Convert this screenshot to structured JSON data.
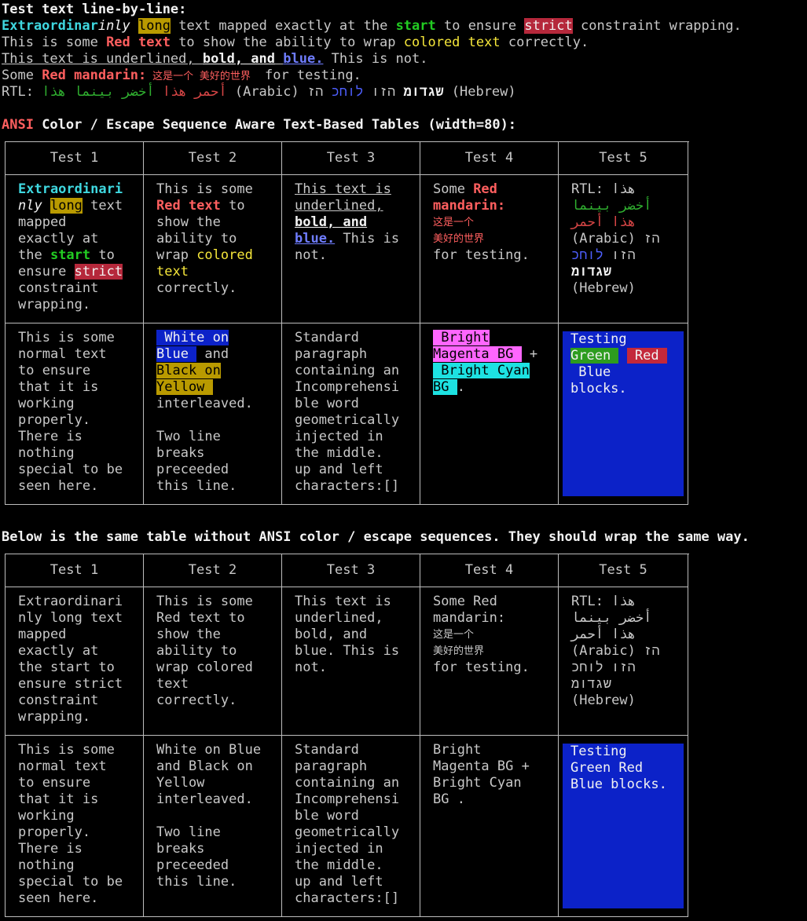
{
  "heading_line_by_line": "Test text line-by-line:",
  "line1": {
    "part_extra": "Extraordinar",
    "part_inly": "inly",
    "part_long": "long",
    "part_a": " text mapped exactly at the ",
    "part_start": "start",
    "part_b": " to ensure ",
    "part_strict": "strict",
    "part_c": " constraint wrapping."
  },
  "line2": {
    "part_a": "This is some ",
    "part_red": "Red text",
    "part_b": " to show the ability to wrap ",
    "part_colored": "colored text",
    "part_c": " correctly."
  },
  "line3": {
    "part_a": "This text is underlined, ",
    "part_bold": "bold, and",
    "part_space": " ",
    "part_blue": "blue.",
    "part_b": " This is not."
  },
  "line4": {
    "part_a": "Some ",
    "part_red": "Red mandarin:",
    "part_cjk": " 这是一个 美好的世界 ",
    "part_b": " for testing."
  },
  "line5": {
    "part_a": "RTL: ",
    "part_red_ar": "أحمر هذا",
    "part_green_ar": " أخضر بينما هذا",
    "part_b": " (Arabic) ",
    "part_bold_he": "שגדומ",
    "part_he1": " הזו ",
    "part_blue_he": "לוחכ",
    "part_he2": " הז",
    "part_c": " (Hebrew)"
  },
  "ansi_heading": {
    "ansi": "ANSI",
    "rest": " Color / Escape Sequence Aware Text-Based Tables (width=80):"
  },
  "plain_heading": "Below is the same table without ANSI color / escape sequences. They should wrap the same way.",
  "table_headers": [
    "Test 1",
    "Test 2",
    "Test 3",
    "Test 4",
    "Test 5"
  ],
  "t1": {
    "c1r1": {
      "l1": "Extraordinari",
      "l2a": "nly",
      "l2b": "long",
      "l2c": " text",
      "l3": "mapped",
      "l4": "exactly at",
      "l5a": "the ",
      "l5b": "start",
      "l5c": " to",
      "l6a": "ensure ",
      "l6b": "strict",
      "l7": "constraint",
      "l8": "wrapping."
    },
    "c2r1": {
      "l1": "This is some",
      "l2a": "Red text",
      "l2b": " to",
      "l3": "show the",
      "l4": "ability to",
      "l5a": "wrap ",
      "l5b": "colored",
      "l6": "text",
      "l7": "correctly."
    },
    "c3r1": {
      "l1": "This text is",
      "l2": "underlined,",
      "l3": "bold, and",
      "l4a": "blue.",
      "l4b": " This is",
      "l5": "not."
    },
    "c4r1": {
      "l1a": "Some ",
      "l1b": "Red",
      "l2": "mandarin:",
      "l3": "这是一个",
      "l4": "美好的世界",
      "l5": "for testing."
    },
    "c5r1": {
      "l1a": "RTL: ",
      "l1b": "هذا",
      "l2": "أخضر بينما",
      "l3": "هذا أحمر",
      "l4a": "(Arabic) ",
      "l4b": "הז",
      "l5a": "הזו ",
      "l5b": "לוחכ",
      "l6": "שגדומ",
      "l7": "(Hebrew)"
    },
    "c1r2": [
      "This is some",
      "normal text",
      "to ensure",
      "that it is",
      "working",
      "properly.",
      "There is",
      "nothing",
      "special to be",
      "seen here."
    ],
    "c2r2": {
      "l1": " White on",
      "l2a": "Blue ",
      "l2b": " and",
      "l3": "Black on",
      "l4": "Yellow ",
      "l5": "interleaved.",
      "l6": "",
      "l7": "Two line",
      "l8": "breaks",
      "l9": "preceeded",
      "l10": "this line."
    },
    "c3r2": [
      "Standard",
      "paragraph",
      "containing an",
      "Incomprehensi",
      "ble word",
      "geometrically",
      "injected in",
      "the middle.",
      "up and left",
      "characters:[]"
    ],
    "c4r2": {
      "l1": " Bright",
      "l2a": "Magenta BG ",
      "l2b": " +",
      "l3": " Bright Cyan",
      "l4a": "BG ",
      "l4b": "."
    },
    "c5r2": {
      "l1": "Testing",
      "l2a": "Green ",
      "l2b": " Red ",
      "l3": " Blue",
      "l4": "blocks."
    }
  },
  "t2": {
    "c1r1": [
      "Extraordinari",
      "nly long text",
      "mapped",
      "exactly at",
      "the start to",
      "ensure strict",
      "constraint",
      "wrapping."
    ],
    "c2r1": [
      "This is some",
      "Red text to",
      "show the",
      "ability to",
      "wrap colored",
      "text",
      "correctly."
    ],
    "c3r1": [
      "This text is",
      "underlined,",
      "bold, and",
      "blue. This is",
      "not."
    ],
    "c4r1": [
      "Some Red",
      "mandarin:",
      "这是一个",
      "美好的世界",
      "for testing."
    ],
    "c5r1": [
      "RTL: هذا",
      "أخضر بينما",
      "هذا أحمر",
      "(Arabic) הז",
      "הזו לוחכ",
      "שגדומ",
      "(Hebrew)"
    ],
    "c1r2": [
      "This is some",
      "normal text",
      "to ensure",
      "that it is",
      "working",
      "properly.",
      "There is",
      "nothing",
      "special to be",
      "seen here."
    ],
    "c2r2": [
      "White on Blue",
      "and Black on",
      "Yellow",
      "interleaved.",
      "",
      "Two line",
      "breaks",
      "preceeded",
      "this line."
    ],
    "c3r2": [
      "Standard",
      "paragraph",
      "containing an",
      "Incomprehensi",
      "ble word",
      "geometrically",
      "injected in",
      "the middle.",
      "up and left",
      "characters:[]"
    ],
    "c4r2": [
      "Bright",
      "Magenta BG +",
      "Bright Cyan",
      "BG ."
    ],
    "c5r2": [
      "Testing",
      "Green Red",
      "Blue blocks."
    ]
  }
}
